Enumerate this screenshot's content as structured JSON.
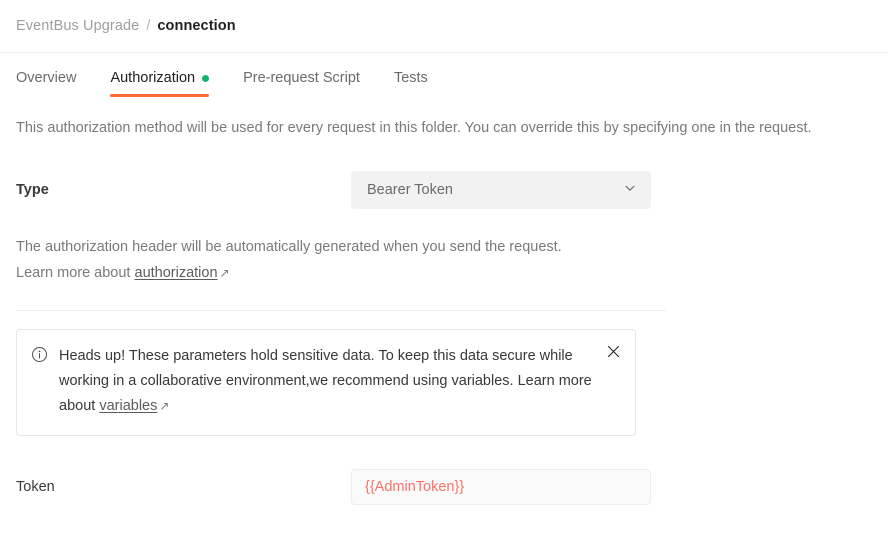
{
  "breadcrumb": {
    "root": "EventBus Upgrade",
    "separator": "/",
    "current": "connection"
  },
  "tabs": [
    {
      "label": "Overview",
      "active": false,
      "has_dot": false
    },
    {
      "label": "Authorization",
      "active": true,
      "has_dot": true
    },
    {
      "label": "Pre-request Script",
      "active": false,
      "has_dot": false
    },
    {
      "label": "Tests",
      "active": false,
      "has_dot": false
    }
  ],
  "folder_description": "This authorization method will be used for every request in this folder. You can override this by specifying one in the request.",
  "type_field": {
    "label": "Type",
    "selected_value": "Bearer Token",
    "chevron_icon": "chevron-down-icon"
  },
  "helper": {
    "text_before": "The authorization header will be automatically generated when you send the request. Learn more about ",
    "link_text": "authorization",
    "external_icon": "↗"
  },
  "callout": {
    "info_icon": "info-circle-icon",
    "close_icon": "close-icon",
    "text_before": "Heads up! These parameters hold sensitive data. To keep this data secure while working in a collaborative environment,we recommend using variables. Learn more about ",
    "link_text": "variables",
    "external_icon": "↗"
  },
  "token_field": {
    "label": "Token",
    "value": "{{AdminToken}}",
    "placeholder": "Token"
  },
  "colors": {
    "accent_orange": "#ff6c37",
    "status_green": "#15b371",
    "variable_red": "#fa7268",
    "select_bg": "#f2f2f3",
    "divider": "#ededed"
  }
}
